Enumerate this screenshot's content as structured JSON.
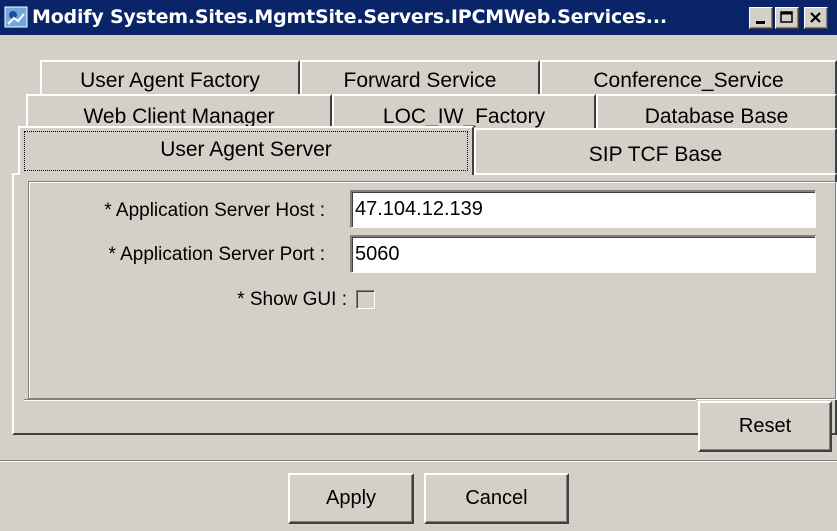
{
  "window": {
    "title": "Modify System.Sites.MgmtSite.Servers.IPCMWeb.Services...",
    "icon": "app-window-icon",
    "controls": [
      "minimize-icon",
      "maximize-icon",
      "close-icon"
    ]
  },
  "tabs": {
    "row1": [
      "User Agent Factory",
      "Forward Service",
      "Conference_Service"
    ],
    "row2": [
      "Web Client Manager",
      "LOC_IW_Factory",
      "Database Base"
    ],
    "row3": [
      "User Agent Server",
      "SIP TCF Base"
    ],
    "selected": "User Agent Server"
  },
  "form": {
    "host_label": "* Application Server Host :",
    "host_value": "47.104.12.139",
    "port_label": "* Application Server Port :",
    "port_value": "5060",
    "gui_label": "* Show GUI :",
    "gui_checked": false
  },
  "buttons": {
    "reset": "Reset",
    "apply": "Apply",
    "cancel": "Cancel"
  },
  "colors": {
    "titlebar": "#0a246a",
    "face": "#d4d0c8"
  }
}
